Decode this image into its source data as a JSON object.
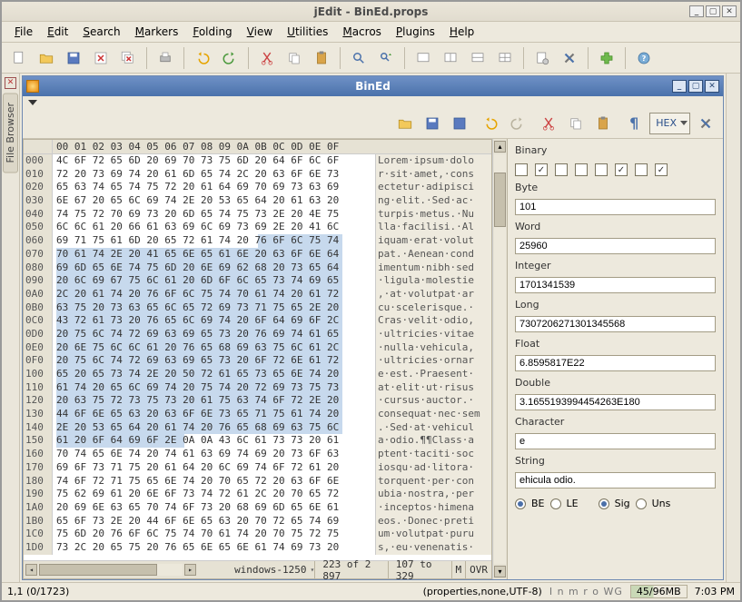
{
  "window": {
    "title": "jEdit - BinEd.props"
  },
  "menu": [
    "File",
    "Edit",
    "Search",
    "Markers",
    "Folding",
    "View",
    "Utilities",
    "Macros",
    "Plugins",
    "Help"
  ],
  "sidebar": {
    "tab": "File Browser"
  },
  "inner": {
    "title": "BinEd",
    "hexmode": "HEX"
  },
  "hex": {
    "header": "00 01 02 03 04 05 06 07 08 09 0A 0B 0C 0D 0E 0F",
    "rows": [
      {
        "a": "000",
        "b": "4C 6F 72 65 6D 20 69 70 73 75 6D 20 64 6F 6C 6F",
        "t": "Lorem·ipsum·dolo"
      },
      {
        "a": "010",
        "b": "72 20 73 69 74 20 61 6D 65 74 2C 20 63 6F 6E 73",
        "t": "r·sit·amet,·cons"
      },
      {
        "a": "020",
        "b": "65 63 74 65 74 75 72 20 61 64 69 70 69 73 63 69",
        "t": "ectetur·adipisci"
      },
      {
        "a": "030",
        "b": "6E 67 20 65 6C 69 74 2E 20 53 65 64 20 61 63 20",
        "t": "ng·elit.·Sed·ac·"
      },
      {
        "a": "040",
        "b": "74 75 72 70 69 73 20 6D 65 74 75 73 2E 20 4E 75",
        "t": "turpis·metus.·Nu"
      },
      {
        "a": "050",
        "b": "6C 6C 61 20 66 61 63 69 6C 69 73 69 2E 20 41 6C",
        "t": "lla·facilisi.·Al"
      },
      {
        "a": "060",
        "b": "69 71 75 61 6D 20 65 72 61 74 20 76 6F 6C 75 74",
        "t": "iquam·erat·volut"
      },
      {
        "a": "070",
        "b": "70 61 74 2E 20 41 65 6E 65 61 6E 20 63 6F 6E 64",
        "t": "pat.·Aenean·cond"
      },
      {
        "a": "080",
        "b": "69 6D 65 6E 74 75 6D 20 6E 69 62 68 20 73 65 64",
        "t": "imentum·nibh·sed"
      },
      {
        "a": "090",
        "b": "20 6C 69 67 75 6C 61 20 6D 6F 6C 65 73 74 69 65",
        "t": "·ligula·molestie"
      },
      {
        "a": "0A0",
        "b": "2C 20 61 74 20 76 6F 6C 75 74 70 61 74 20 61 72",
        "t": ",·at·volutpat·ar"
      },
      {
        "a": "0B0",
        "b": "63 75 20 73 63 65 6C 65 72 69 73 71 75 65 2E 20",
        "t": "cu·scelerisque.·"
      },
      {
        "a": "0C0",
        "b": "43 72 61 73 20 76 65 6C 69 74 20 6F 64 69 6F 2C",
        "t": "Cras·velit·odio,"
      },
      {
        "a": "0D0",
        "b": "20 75 6C 74 72 69 63 69 65 73 20 76 69 74 61 65",
        "t": "·ultricies·vitae"
      },
      {
        "a": "0E0",
        "b": "20 6E 75 6C 6C 61 20 76 65 68 69 63 75 6C 61 2C",
        "t": "·nulla·vehicula,"
      },
      {
        "a": "0F0",
        "b": "20 75 6C 74 72 69 63 69 65 73 20 6F 72 6E 61 72",
        "t": "·ultricies·ornar"
      },
      {
        "a": "100",
        "b": "65 20 65 73 74 2E 20 50 72 61 65 73 65 6E 74 20",
        "t": "e·est.·Praesent·"
      },
      {
        "a": "110",
        "b": "61 74 20 65 6C 69 74 20 75 74 20 72 69 73 75 73",
        "t": "at·elit·ut·risus"
      },
      {
        "a": "120",
        "b": "20 63 75 72 73 75 73 20 61 75 63 74 6F 72 2E 20",
        "t": "·cursus·auctor.·"
      },
      {
        "a": "130",
        "b": "44 6F 6E 65 63 20 63 6F 6E 73 65 71 75 61 74 20",
        "t": "consequat·nec·sem"
      },
      {
        "a": "140",
        "b": "2E 20 53 65 64 20 61 74 20 76 65 68 69 63 75 6C",
        "t": ".·Sed·at·vehicul"
      },
      {
        "a": "150",
        "b": "61 20 6F 64 69 6F 2E 0A 0A 43 6C 61 73 73 20 61",
        "t": "a·odio.¶¶Class·a"
      },
      {
        "a": "160",
        "b": "70 74 65 6E 74 20 74 61 63 69 74 69 20 73 6F 63",
        "t": "ptent·taciti·soc"
      },
      {
        "a": "170",
        "b": "69 6F 73 71 75 20 61 64 20 6C 69 74 6F 72 61 20",
        "t": "iosqu·ad·litora·"
      },
      {
        "a": "180",
        "b": "74 6F 72 71 75 65 6E 74 20 70 65 72 20 63 6F 6E",
        "t": "torquent·per·con"
      },
      {
        "a": "190",
        "b": "75 62 69 61 20 6E 6F 73 74 72 61 2C 20 70 65 72",
        "t": "ubia·nostra,·per"
      },
      {
        "a": "1A0",
        "b": "20 69 6E 63 65 70 74 6F 73 20 68 69 6D 65 6E 61",
        "t": "·inceptos·himena"
      },
      {
        "a": "1B0",
        "b": "65 6F 73 2E 20 44 6F 6E 65 63 20 70 72 65 74 69",
        "t": "eos.·Donec·preti"
      },
      {
        "a": "1C0",
        "b": "75 6D 20 76 6F 6C 75 74 70 61 74 20 70 75 72 75",
        "t": "um·volutpat·puru"
      },
      {
        "a": "1D0",
        "b": "73 2C 20 65 75 20 76 65 6E 65 6E 61 74 69 73 20",
        "t": "s,·eu·venenatis·"
      }
    ],
    "encoding": "windows-1250",
    "position": "223 of 2 897",
    "selection": "107 to 329",
    "mode_m": "M",
    "mode_ovr": "OVR"
  },
  "inspector": {
    "binary_label": "Binary",
    "checks": [
      false,
      true,
      false,
      false,
      false,
      true,
      false,
      true
    ],
    "byte_label": "Byte",
    "byte": "101",
    "word_label": "Word",
    "word": "25960",
    "integer_label": "Integer",
    "integer": "1701341539",
    "long_label": "Long",
    "long": "7307206271301345568",
    "float_label": "Float",
    "float": "6.8595817E22",
    "double_label": "Double",
    "double": "3.1655193994454263E180",
    "character_label": "Character",
    "character": "e",
    "string_label": "String",
    "string": "ehicula odio.",
    "be": "BE",
    "le": "LE",
    "sig": "Sig",
    "uns": "Uns"
  },
  "status": {
    "pos": "1,1 (0/1723)",
    "props": "(properties,none,UTF-8)",
    "flags": "I n m r o WG",
    "mem": "45/96MB",
    "time": "7:03 PM"
  }
}
